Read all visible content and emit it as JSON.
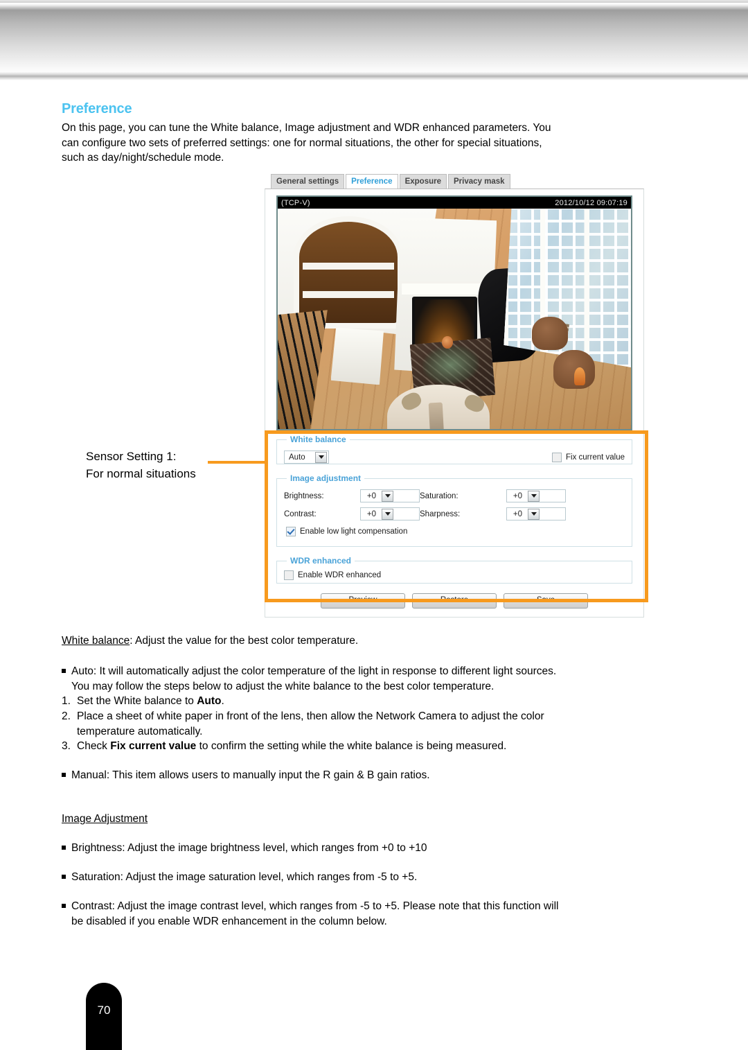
{
  "header": {
    "heading": "Preference",
    "intro_line1": "On this page, you can tune the White balance, Image adjustment and WDR enhanced parameters. You",
    "intro_line2": "can configure two sets of preferred settings: one for normal situations, the other for special situations,",
    "intro_line3": "such as day/night/schedule mode."
  },
  "callout": {
    "line1": "Sensor Setting 1:",
    "line2": "For normal situations"
  },
  "ui": {
    "tabs": [
      {
        "label": "General settings",
        "active": false
      },
      {
        "label": "Preference",
        "active": true
      },
      {
        "label": "Exposure",
        "active": false
      },
      {
        "label": "Privacy mask",
        "active": false
      }
    ],
    "viewer": {
      "stream_label": "(TCP-V)",
      "timestamp": "2012/10/12 09:07:19"
    },
    "white_balance": {
      "legend": "White balance",
      "mode_value": "Auto",
      "fix_current_value_label": "Fix current value",
      "fix_current_value_checked": false
    },
    "image_adjustment": {
      "legend": "Image adjustment",
      "brightness_label": "Brightness:",
      "brightness_value": "+0",
      "saturation_label": "Saturation:",
      "saturation_value": "+0",
      "contrast_label": "Contrast:",
      "contrast_value": "+0",
      "sharpness_label": "Sharpness:",
      "sharpness_value": "+0",
      "low_light_label": "Enable low light compensation",
      "low_light_checked": true
    },
    "wdr": {
      "legend": "WDR enhanced",
      "enable_label": "Enable WDR enhanced",
      "enable_checked": false
    },
    "buttons": {
      "preview": "Preview",
      "restore": "Restore",
      "save": "Save"
    }
  },
  "body": {
    "wb_term": "White balance",
    "wb_rest": ": Adjust the value for the best color temperature.",
    "auto_line1": "Auto: It will automatically adjust the color temperature of the light in response to different light sources.",
    "auto_line2": "You may follow the steps below to adjust the white balance to the best color temperature.",
    "step1_num": "1.",
    "step1_a": "Set the White balance to ",
    "step1_b": "Auto",
    "step1_c": ".",
    "step2_num": "2.",
    "step2_line1": "Place a sheet of white paper in front of the lens, then allow the Network Camera to adjust the color",
    "step2_line2": "temperature automatically.",
    "step3_num": "3.",
    "step3_a": "Check ",
    "step3_b": "Fix current value",
    "step3_c": " to confirm the setting while the white balance is being measured.",
    "manual_line": "Manual: This item allows users to manually input the R gain & B gain ratios.",
    "image_adj_heading": "Image Adjustment",
    "brightness_bullet": "Brightness: Adjust the image brightness level, which ranges from +0 to +10",
    "saturation_bullet": "Saturation: Adjust the image saturation level, which ranges from -5 to +5.",
    "contrast_bullet_l1": "Contrast: Adjust the image contrast level, which ranges from -5 to +5. Please note that this function will",
    "contrast_bullet_l2": "be disabled if you enable WDR enhancement in the column below."
  },
  "footer": {
    "page_number": "70"
  },
  "colors": {
    "heading": "#4cc3f0",
    "legend": "#4aa3d8",
    "callout": "#f79a1e",
    "active_tab_text": "#2f9fd8"
  }
}
